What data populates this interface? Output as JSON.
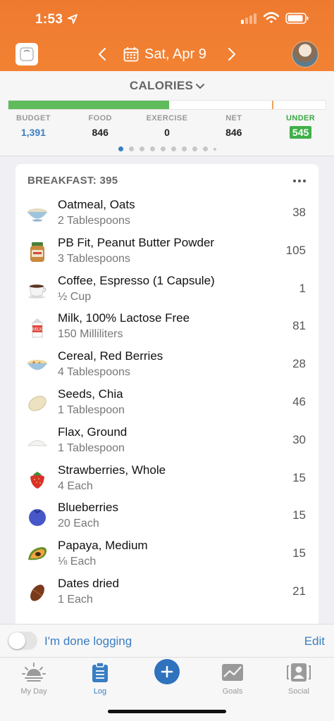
{
  "status_bar": {
    "time": "1:53"
  },
  "header": {
    "date": "Sat, Apr 9"
  },
  "summary": {
    "title": "CALORIES",
    "progress_fraction": 0.506,
    "budget_marker_fraction": 0.832,
    "stats": [
      {
        "key": "budget",
        "label": "BUDGET",
        "value": "1,391"
      },
      {
        "key": "food",
        "label": "FOOD",
        "value": "846"
      },
      {
        "key": "exercise",
        "label": "EXERCISE",
        "value": "0"
      },
      {
        "key": "net",
        "label": "NET",
        "value": "846"
      },
      {
        "key": "under",
        "label": "UNDER",
        "value": "545"
      }
    ],
    "page_count": 10,
    "active_page": 0
  },
  "meal": {
    "title": "BREAKFAST: 395",
    "items": [
      {
        "name": "Oatmeal, Oats",
        "qty": "2 Tablespoons",
        "cal": "38",
        "icon": "oatmeal-bowl-icon"
      },
      {
        "name": "PB Fit, Peanut Butter Powder",
        "qty": "3 Tablespoons",
        "cal": "105",
        "icon": "peanut-butter-jar-icon"
      },
      {
        "name": "Coffee, Espresso (1 Capsule)",
        "qty": "½ Cup",
        "cal": "1",
        "icon": "coffee-cup-icon"
      },
      {
        "name": "Milk, 100% Lactose Free",
        "qty": "150 Milliliters",
        "cal": "81",
        "icon": "milk-carton-icon"
      },
      {
        "name": "Cereal, Red Berries",
        "qty": "4 Tablespoons",
        "cal": "28",
        "icon": "cereal-bowl-icon"
      },
      {
        "name": "Seeds, Chia",
        "qty": "1 Tablespoon",
        "cal": "46",
        "icon": "seed-icon"
      },
      {
        "name": "Flax, Ground",
        "qty": "1 Tablespoon",
        "cal": "30",
        "icon": "ground-flax-icon"
      },
      {
        "name": "Strawberries, Whole",
        "qty": "4 Each",
        "cal": "15",
        "icon": "strawberry-icon"
      },
      {
        "name": "Blueberries",
        "qty": "20 Each",
        "cal": "15",
        "icon": "blueberry-icon"
      },
      {
        "name": "Papaya, Medium",
        "qty": "⅛ Each",
        "cal": "15",
        "icon": "papaya-icon"
      },
      {
        "name": "Dates dried",
        "qty": "1 Each",
        "cal": "21",
        "icon": "date-fruit-icon"
      }
    ]
  },
  "done_bar": {
    "label": "I'm done logging",
    "edit": "Edit"
  },
  "tabs": [
    {
      "key": "myday",
      "label": "My Day",
      "icon": "sunrise-icon"
    },
    {
      "key": "log",
      "label": "Log",
      "icon": "clipboard-icon"
    },
    {
      "key": "add",
      "label": "",
      "icon": "plus-icon"
    },
    {
      "key": "goals",
      "label": "Goals",
      "icon": "goals-chart-icon"
    },
    {
      "key": "social",
      "label": "Social",
      "icon": "social-person-icon"
    }
  ],
  "colors": {
    "header_orange": "#f07c32",
    "accent_blue": "#3a7ec3",
    "progress_green": "#5fbb5b",
    "under_green": "#40b04a"
  }
}
